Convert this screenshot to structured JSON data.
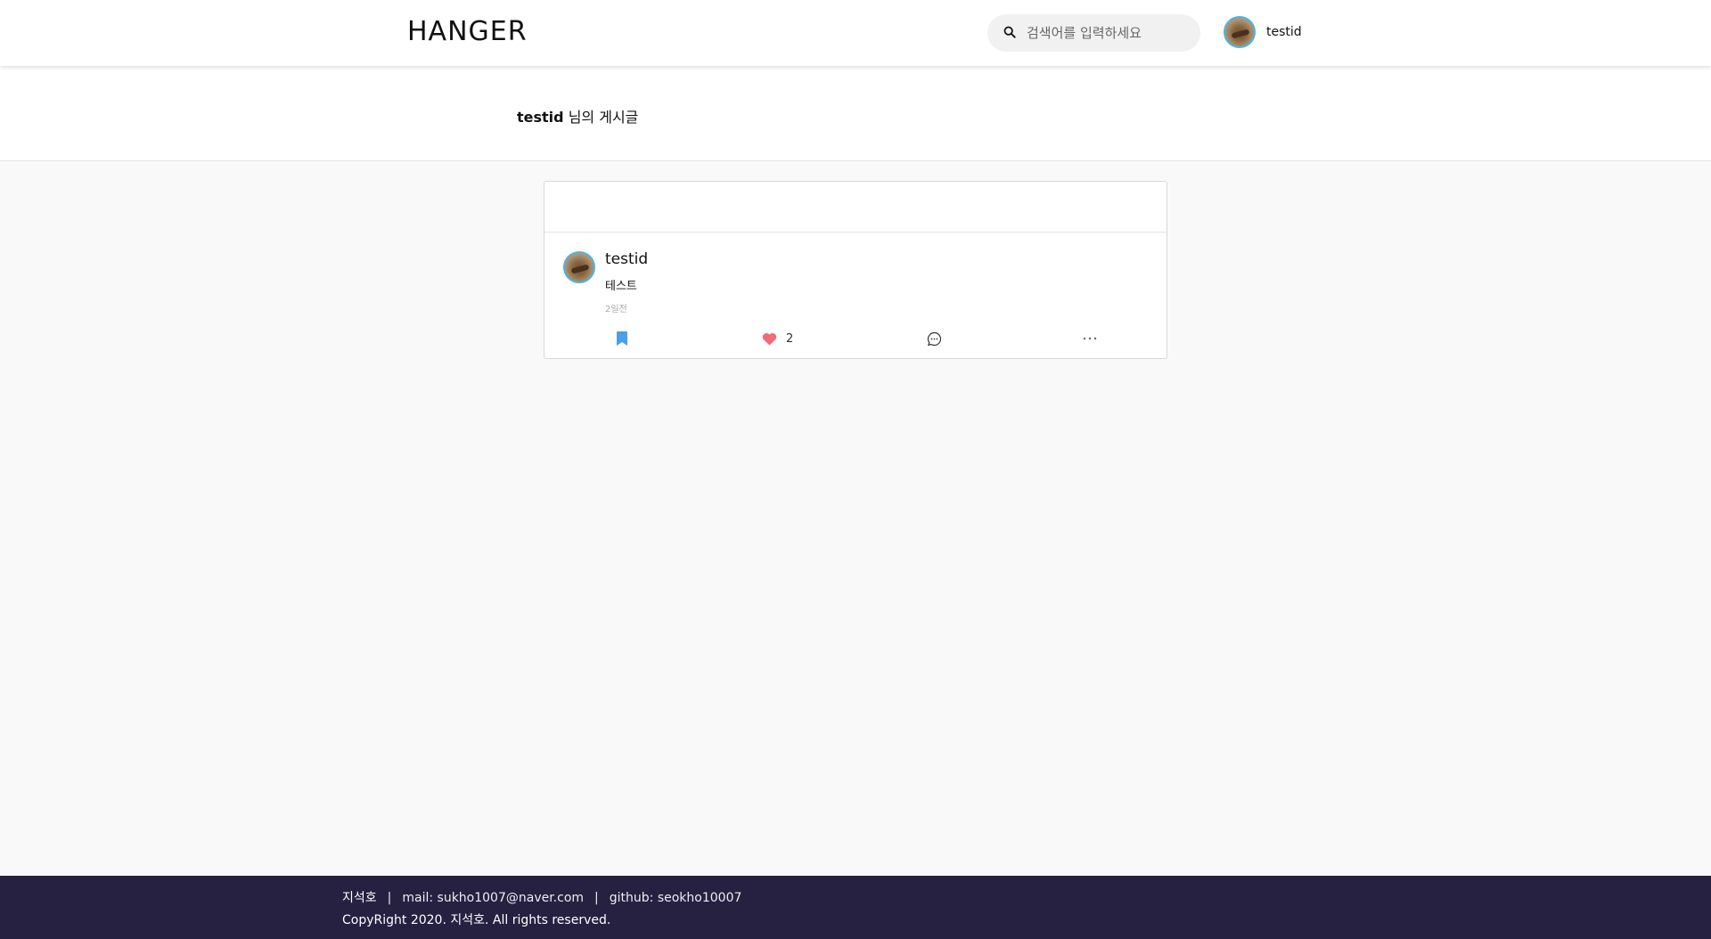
{
  "header": {
    "logo": "HANGER",
    "search": {
      "placeholder": "검색어를 입력하세요",
      "value": ""
    },
    "user": {
      "name": "testid"
    }
  },
  "page": {
    "title_user": "testid",
    "title_suffix": " 님의 게시글"
  },
  "post": {
    "author": "testid",
    "text": "테스트",
    "time": "2일전",
    "like_count": "2"
  },
  "footer": {
    "name": "지석호",
    "separator": "|",
    "mail": "mail: sukho1007@naver.com",
    "github": "github: seokho10007",
    "copyright": "CopyRight 2020. 지석호. All rights reserved."
  },
  "colors": {
    "accent_blue": "#4a9fe8",
    "like_red": "#f06b75",
    "footer_bg": "#262041"
  },
  "icons": [
    "search-icon",
    "bookmark-icon",
    "heart-icon",
    "comment-icon",
    "more-icon"
  ]
}
